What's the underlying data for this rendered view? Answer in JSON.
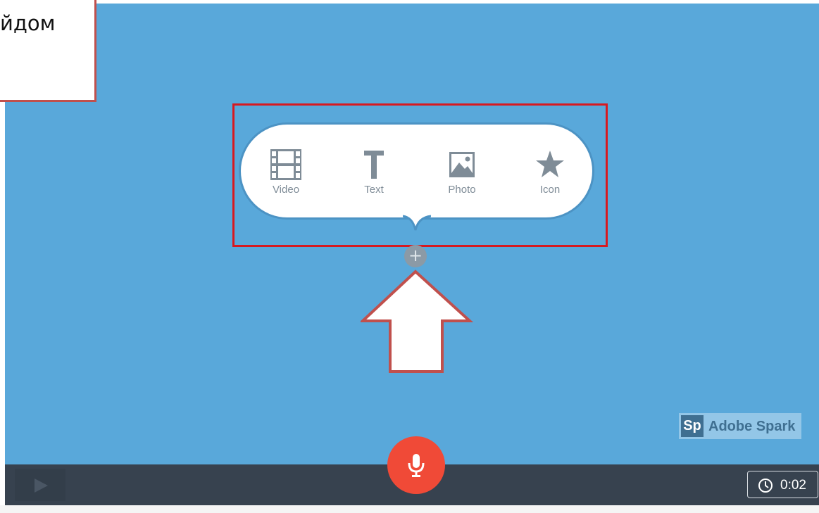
{
  "callout": {
    "text": "йдом"
  },
  "popup": {
    "items": [
      {
        "label": "Video",
        "icon": "film-icon"
      },
      {
        "label": "Text",
        "icon": "text-t-icon"
      },
      {
        "label": "Photo",
        "icon": "image-icon"
      },
      {
        "label": "Icon",
        "icon": "star-icon"
      }
    ]
  },
  "add_button": {
    "symbol": "+"
  },
  "branding": {
    "badge": "Sp",
    "name": "Adobe Spark"
  },
  "player": {
    "timer": "0:02"
  },
  "colors": {
    "stage_background": "#59a8da",
    "highlight": "#d71920",
    "callout_border": "#c0504d",
    "record_button": "#f04a37",
    "bottom_bar": "#37424f"
  }
}
